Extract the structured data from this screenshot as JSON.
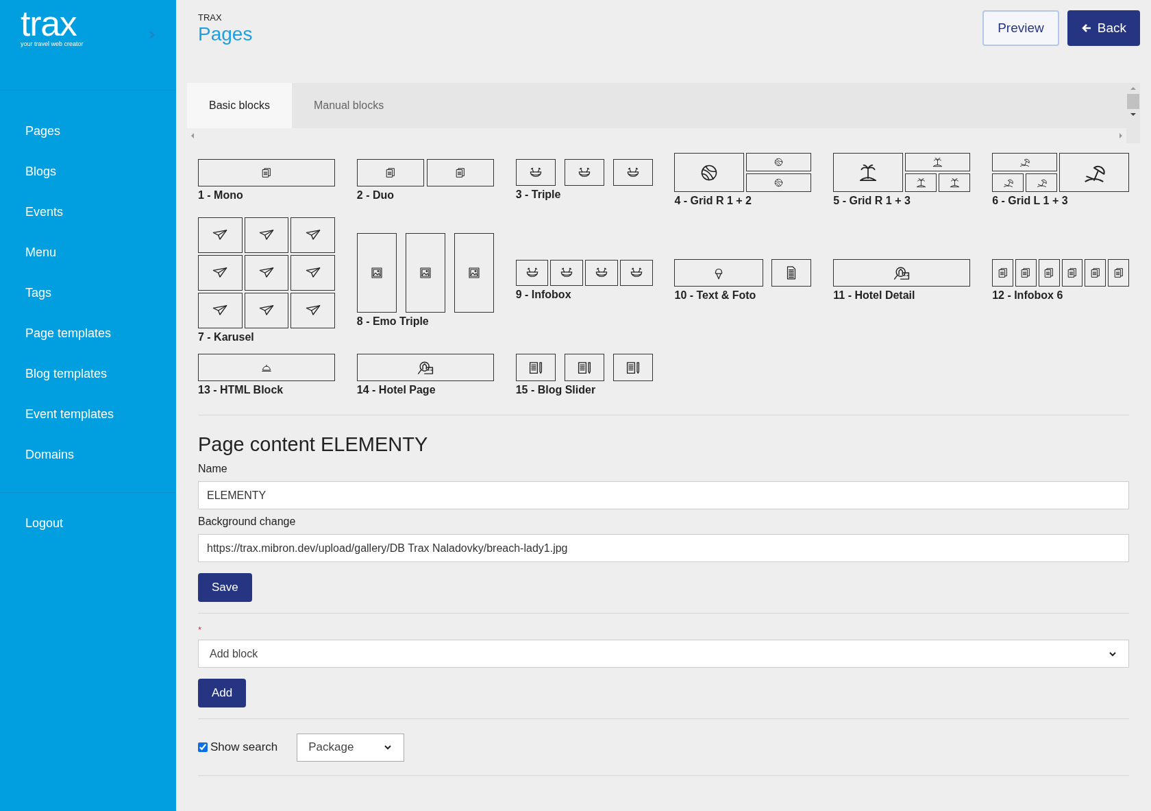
{
  "sidebar": {
    "logo": "trax",
    "tagline": "your travel web creator",
    "items": [
      {
        "label": "Pages"
      },
      {
        "label": "Blogs"
      },
      {
        "label": "Events"
      },
      {
        "label": "Menu"
      },
      {
        "label": "Tags"
      },
      {
        "label": "Page templates"
      },
      {
        "label": "Blog templates"
      },
      {
        "label": "Event templates"
      },
      {
        "label": "Domains"
      }
    ],
    "logout": "Logout"
  },
  "header": {
    "eyebrow": "TRAX",
    "title": "Pages",
    "buttons": [
      {
        "label": "Preview",
        "kind": "outline"
      },
      {
        "label": "Back",
        "kind": "primary"
      }
    ]
  },
  "tabs": [
    {
      "label": "Basic blocks",
      "selected": true
    },
    {
      "label": "Manual blocks",
      "selected": false
    }
  ],
  "block_rows": [
    [
      {
        "label": "1 - Mono",
        "kind": "mono"
      },
      {
        "label": "2 - Duo",
        "kind": "duo"
      },
      {
        "label": "3 - Triple",
        "kind": "triple"
      },
      {
        "label": "4 - Grid R 1 + 2",
        "kind": "grid-r-1-2"
      },
      {
        "label": "5 - Grid R 1 + 3",
        "kind": "grid-r-1-3"
      },
      {
        "label": "6 - Grid L 1 + 3",
        "kind": "grid-l-1-3"
      }
    ],
    [
      {
        "label": "7 - Karusel",
        "kind": "karusel"
      },
      {
        "label": "8 - Emo Triple",
        "kind": "emo-triple"
      },
      {
        "label": "9 - Infobox",
        "kind": "infobox"
      },
      {
        "label": "10 - Text & Foto",
        "kind": "text-foto"
      },
      {
        "label": "11 - Hotel Detail",
        "kind": "hotel-detail"
      },
      {
        "label": "12 - Infobox 6",
        "kind": "infobox6"
      }
    ],
    [
      {
        "label": "13 - HTML Block",
        "kind": "html"
      },
      {
        "label": "14 - Hotel Page",
        "kind": "hotel-page"
      },
      {
        "label": "15 - Blog Slider",
        "kind": "blog-slider"
      }
    ]
  ],
  "content": {
    "heading": "Page content ELEMENTY",
    "fields": [
      {
        "label": "Name",
        "value": "ELEMENTY"
      },
      {
        "label": "Background change",
        "value": "https://trax.mibron.dev/upload/gallery/DB Trax Naladovky/breach-lady1.jpg"
      }
    ],
    "save": "Save",
    "required_mark": "*",
    "block_select": {
      "value": "Add block"
    },
    "add": "Add",
    "show_search": {
      "label": "Show search",
      "checked": true
    },
    "search_type": {
      "value": "Package"
    }
  }
}
